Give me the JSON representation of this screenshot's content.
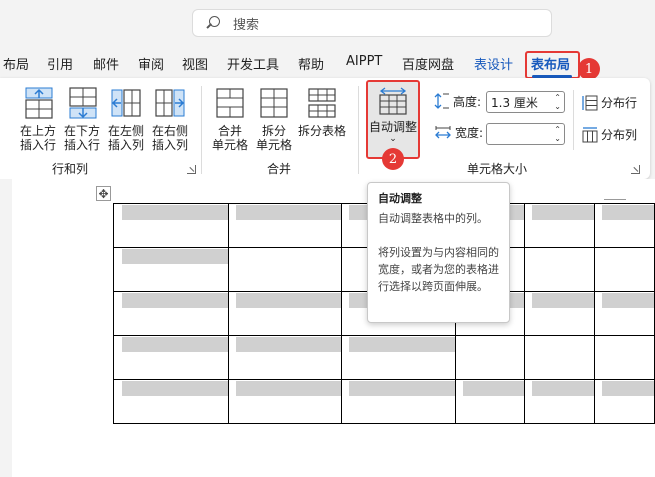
{
  "search": {
    "placeholder": "搜索"
  },
  "tabs": [
    {
      "label": "布局"
    },
    {
      "label": "引用"
    },
    {
      "label": "邮件"
    },
    {
      "label": "审阅"
    },
    {
      "label": "视图"
    },
    {
      "label": "开发工具"
    },
    {
      "label": "帮助"
    },
    {
      "label": "AIPPT"
    },
    {
      "label": "百度网盘"
    },
    {
      "label": "表设计"
    },
    {
      "label": "表布局"
    }
  ],
  "badges": {
    "one": "1",
    "two": "2"
  },
  "ribbon": {
    "rows_cols": {
      "insert_above": "在上方\n插入行",
      "insert_below": "在下方\n插入行",
      "insert_left": "在左侧\n插入列",
      "insert_right": "在右侧\n插入列",
      "label": "行和列"
    },
    "merge": {
      "merge_cells": "合并\n单元格",
      "split_cells": "拆分\n单元格",
      "split_table": "拆分表格",
      "label": "合并"
    },
    "cell_size": {
      "autofit": "自动调整",
      "height_label": "高度:",
      "height_value": "1.3 厘米",
      "width_label": "宽度:",
      "width_value": "",
      "distribute_rows": "分布行",
      "distribute_cols": "分布列",
      "label": "单元格大小"
    }
  },
  "tooltip": {
    "title": "自动调整",
    "desc": "自动调整表格中的列。",
    "detail": "将列设置为与内容相同的宽度，或者为您的表格进行选择以跨页面伸展。"
  },
  "colors": {
    "accent": "#185abd",
    "highlight": "#e53935"
  }
}
